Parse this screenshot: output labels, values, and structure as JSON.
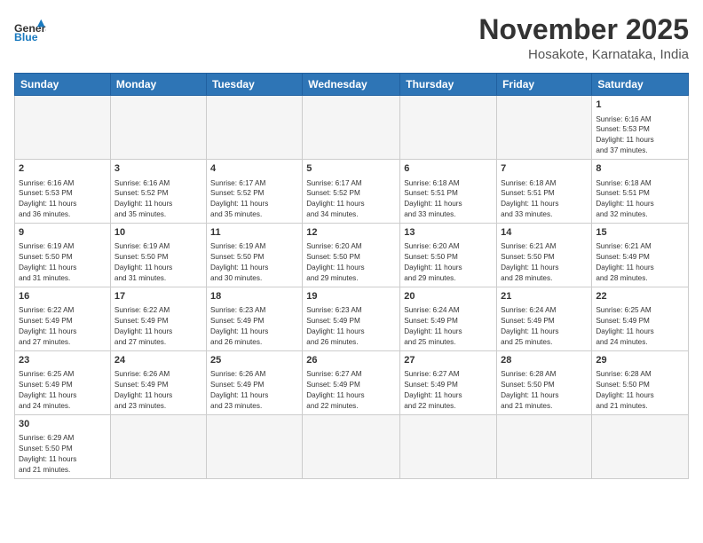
{
  "header": {
    "logo_general": "General",
    "logo_blue": "Blue",
    "month_title": "November 2025",
    "location": "Hosakote, Karnataka, India"
  },
  "weekdays": [
    "Sunday",
    "Monday",
    "Tuesday",
    "Wednesday",
    "Thursday",
    "Friday",
    "Saturday"
  ],
  "weeks": [
    [
      {
        "day": "",
        "info": ""
      },
      {
        "day": "",
        "info": ""
      },
      {
        "day": "",
        "info": ""
      },
      {
        "day": "",
        "info": ""
      },
      {
        "day": "",
        "info": ""
      },
      {
        "day": "",
        "info": ""
      },
      {
        "day": "1",
        "info": "Sunrise: 6:16 AM\nSunset: 5:53 PM\nDaylight: 11 hours\nand 37 minutes."
      }
    ],
    [
      {
        "day": "2",
        "info": "Sunrise: 6:16 AM\nSunset: 5:53 PM\nDaylight: 11 hours\nand 36 minutes."
      },
      {
        "day": "3",
        "info": "Sunrise: 6:16 AM\nSunset: 5:52 PM\nDaylight: 11 hours\nand 35 minutes."
      },
      {
        "day": "4",
        "info": "Sunrise: 6:17 AM\nSunset: 5:52 PM\nDaylight: 11 hours\nand 35 minutes."
      },
      {
        "day": "5",
        "info": "Sunrise: 6:17 AM\nSunset: 5:52 PM\nDaylight: 11 hours\nand 34 minutes."
      },
      {
        "day": "6",
        "info": "Sunrise: 6:18 AM\nSunset: 5:51 PM\nDaylight: 11 hours\nand 33 minutes."
      },
      {
        "day": "7",
        "info": "Sunrise: 6:18 AM\nSunset: 5:51 PM\nDaylight: 11 hours\nand 33 minutes."
      },
      {
        "day": "8",
        "info": "Sunrise: 6:18 AM\nSunset: 5:51 PM\nDaylight: 11 hours\nand 32 minutes."
      }
    ],
    [
      {
        "day": "9",
        "info": "Sunrise: 6:19 AM\nSunset: 5:50 PM\nDaylight: 11 hours\nand 31 minutes."
      },
      {
        "day": "10",
        "info": "Sunrise: 6:19 AM\nSunset: 5:50 PM\nDaylight: 11 hours\nand 31 minutes."
      },
      {
        "day": "11",
        "info": "Sunrise: 6:19 AM\nSunset: 5:50 PM\nDaylight: 11 hours\nand 30 minutes."
      },
      {
        "day": "12",
        "info": "Sunrise: 6:20 AM\nSunset: 5:50 PM\nDaylight: 11 hours\nand 29 minutes."
      },
      {
        "day": "13",
        "info": "Sunrise: 6:20 AM\nSunset: 5:50 PM\nDaylight: 11 hours\nand 29 minutes."
      },
      {
        "day": "14",
        "info": "Sunrise: 6:21 AM\nSunset: 5:50 PM\nDaylight: 11 hours\nand 28 minutes."
      },
      {
        "day": "15",
        "info": "Sunrise: 6:21 AM\nSunset: 5:49 PM\nDaylight: 11 hours\nand 28 minutes."
      }
    ],
    [
      {
        "day": "16",
        "info": "Sunrise: 6:22 AM\nSunset: 5:49 PM\nDaylight: 11 hours\nand 27 minutes."
      },
      {
        "day": "17",
        "info": "Sunrise: 6:22 AM\nSunset: 5:49 PM\nDaylight: 11 hours\nand 27 minutes."
      },
      {
        "day": "18",
        "info": "Sunrise: 6:23 AM\nSunset: 5:49 PM\nDaylight: 11 hours\nand 26 minutes."
      },
      {
        "day": "19",
        "info": "Sunrise: 6:23 AM\nSunset: 5:49 PM\nDaylight: 11 hours\nand 26 minutes."
      },
      {
        "day": "20",
        "info": "Sunrise: 6:24 AM\nSunset: 5:49 PM\nDaylight: 11 hours\nand 25 minutes."
      },
      {
        "day": "21",
        "info": "Sunrise: 6:24 AM\nSunset: 5:49 PM\nDaylight: 11 hours\nand 25 minutes."
      },
      {
        "day": "22",
        "info": "Sunrise: 6:25 AM\nSunset: 5:49 PM\nDaylight: 11 hours\nand 24 minutes."
      }
    ],
    [
      {
        "day": "23",
        "info": "Sunrise: 6:25 AM\nSunset: 5:49 PM\nDaylight: 11 hours\nand 24 minutes."
      },
      {
        "day": "24",
        "info": "Sunrise: 6:26 AM\nSunset: 5:49 PM\nDaylight: 11 hours\nand 23 minutes."
      },
      {
        "day": "25",
        "info": "Sunrise: 6:26 AM\nSunset: 5:49 PM\nDaylight: 11 hours\nand 23 minutes."
      },
      {
        "day": "26",
        "info": "Sunrise: 6:27 AM\nSunset: 5:49 PM\nDaylight: 11 hours\nand 22 minutes."
      },
      {
        "day": "27",
        "info": "Sunrise: 6:27 AM\nSunset: 5:49 PM\nDaylight: 11 hours\nand 22 minutes."
      },
      {
        "day": "28",
        "info": "Sunrise: 6:28 AM\nSunset: 5:50 PM\nDaylight: 11 hours\nand 21 minutes."
      },
      {
        "day": "29",
        "info": "Sunrise: 6:28 AM\nSunset: 5:50 PM\nDaylight: 11 hours\nand 21 minutes."
      }
    ],
    [
      {
        "day": "30",
        "info": "Sunrise: 6:29 AM\nSunset: 5:50 PM\nDaylight: 11 hours\nand 21 minutes."
      },
      {
        "day": "",
        "info": ""
      },
      {
        "day": "",
        "info": ""
      },
      {
        "day": "",
        "info": ""
      },
      {
        "day": "",
        "info": ""
      },
      {
        "day": "",
        "info": ""
      },
      {
        "day": "",
        "info": ""
      }
    ]
  ]
}
